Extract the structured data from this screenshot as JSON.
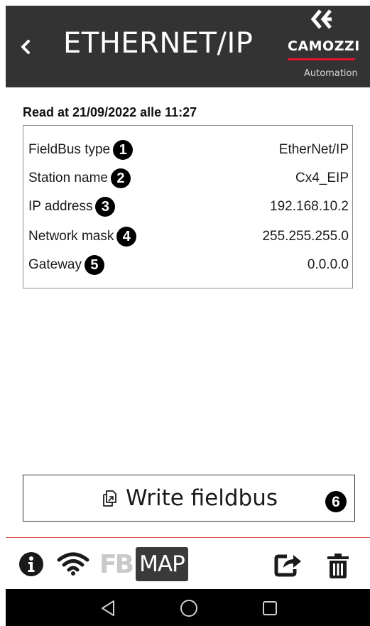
{
  "header": {
    "title": "ETHERNET/IP",
    "back_icon": "chevron-left-icon"
  },
  "logo": {
    "name": "CAMOZZI",
    "subtitle": "Automation",
    "accent_color": "#e3152b"
  },
  "read_at": "Read at 21/09/2022 alle 11:27",
  "fields": [
    {
      "label": "FieldBus type",
      "marker": "1",
      "value": "EtherNet/IP"
    },
    {
      "label": "Station name",
      "marker": "2",
      "value": "Cx4_EIP"
    },
    {
      "label": "IP address",
      "marker": "3",
      "value": "192.168.10.2"
    },
    {
      "label": "Network mask",
      "marker": "4",
      "value": "255.255.255.0"
    },
    {
      "label": "Gateway",
      "marker": "5",
      "value": "0.0.0.0"
    }
  ],
  "write_button": {
    "label": "Write fieldbus",
    "icon": "copy-icon",
    "marker": "6"
  },
  "toolbar": {
    "info_icon": "info-icon",
    "wifi_icon": "wifi-icon",
    "fb_label": "FB",
    "map_label": "MAP",
    "share_icon": "share-icon",
    "trash_icon": "trash-icon"
  },
  "navbar": {
    "back": "nav-back-icon",
    "home": "nav-home-icon",
    "recents": "nav-recents-icon"
  },
  "colors": {
    "header_bg": "#333333",
    "divider": "#d9534f",
    "fb_disabled": "#c9c9c9"
  }
}
